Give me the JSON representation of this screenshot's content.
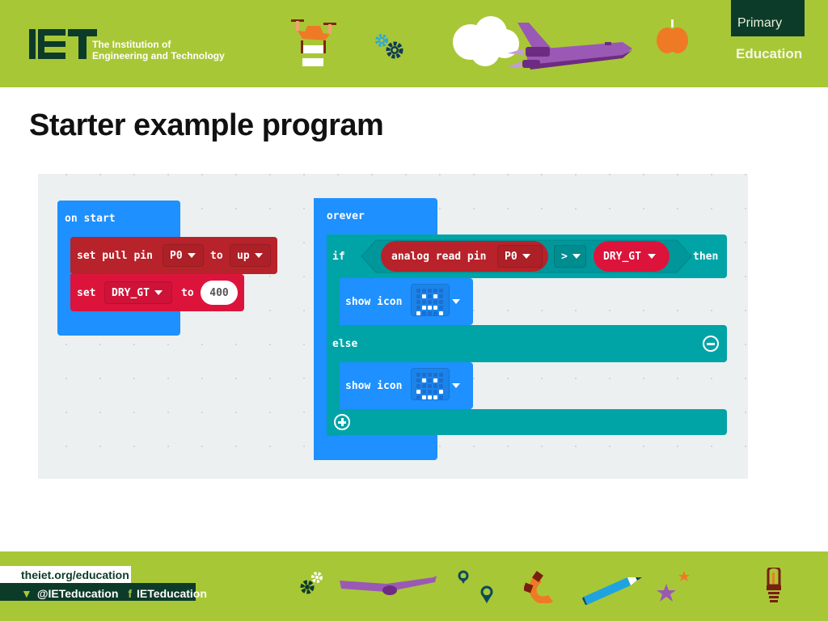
{
  "header": {
    "org_line1": "The Institution of",
    "org_line2": "Engineering and Technology",
    "badge_line1": "Primary",
    "badge_line2": "Education"
  },
  "title": "Starter example program",
  "colors": {
    "band_green": "#a8c736",
    "iet_dark": "#0d3b2a",
    "block_blue": "#1e90ff",
    "block_teal": "#00a4a6",
    "block_pins_red": "#b8222a",
    "block_var_red": "#dc143c",
    "workspace_bg": "#ecf0f1"
  },
  "on_start": {
    "label": "on start",
    "set_pull": {
      "prefix": "set pull pin",
      "pin": "P0",
      "to": "to",
      "mode": "up"
    },
    "set_var": {
      "prefix": "set",
      "variable": "DRY_GT",
      "to": "to",
      "value": "400"
    }
  },
  "forever": {
    "label": "forever",
    "if_block": {
      "if_label": "if",
      "reporter_prefix": "analog read pin",
      "reporter_pin": "P0",
      "operator": ">",
      "compare_variable": "DRY_GT",
      "then_label": "then",
      "then_statement": {
        "label": "show icon",
        "icon_name": "sad-face-icon",
        "grid": [
          [
            0,
            0,
            0,
            0,
            0
          ],
          [
            0,
            1,
            0,
            1,
            0
          ],
          [
            0,
            0,
            0,
            0,
            0
          ],
          [
            0,
            1,
            1,
            1,
            0
          ],
          [
            1,
            0,
            0,
            0,
            1
          ]
        ]
      },
      "else_label": "else",
      "else_statement": {
        "label": "show icon",
        "icon_name": "happy-face-icon",
        "grid": [
          [
            0,
            0,
            0,
            0,
            0
          ],
          [
            0,
            1,
            0,
            1,
            0
          ],
          [
            0,
            0,
            0,
            0,
            0
          ],
          [
            1,
            0,
            0,
            0,
            1
          ],
          [
            0,
            1,
            1,
            1,
            0
          ]
        ]
      }
    }
  },
  "footer": {
    "url": "theiet.org/education",
    "twitter": "@IETeducation",
    "facebook": "IETeducation",
    "twitter_icon": "twitter-bird-icon",
    "facebook_icon": "facebook-f-icon"
  }
}
